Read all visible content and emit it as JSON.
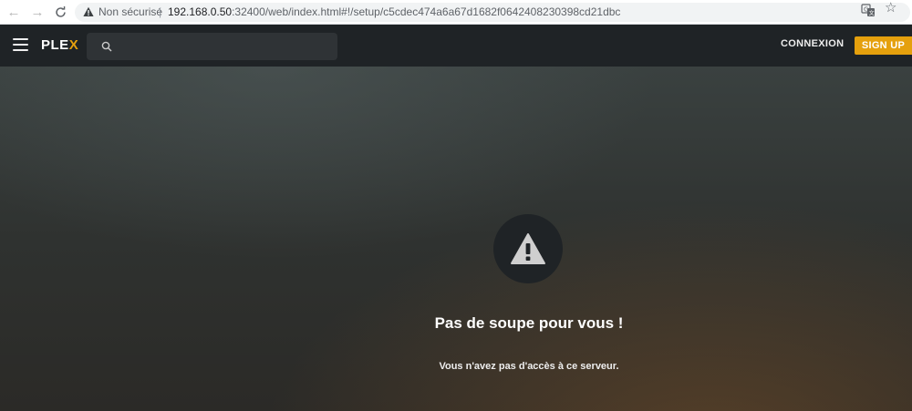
{
  "browser": {
    "back_glyph": "←",
    "forward_glyph": "→",
    "reload_glyph": "C",
    "security_label": "Non sécurisé",
    "url_host": "192.168.0.50",
    "url_path": ":32400/web/index.html#!/setup/c5cdec474a6a67d1682f0642408230398cd21dbc",
    "star_glyph": "☆"
  },
  "header": {
    "logo_prefix": "PLE",
    "logo_x": "X",
    "search_value": "",
    "login_label": "CONNEXION",
    "signup_label": "SIGN UP"
  },
  "error": {
    "title": "Pas de soupe pour vous !",
    "message": "Vous n'avez pas d'accès à ce serveur."
  },
  "colors": {
    "accent": "#e5a00d",
    "header_bg": "#1f2326",
    "alert_circle": "#1f2326",
    "alert_triangle": "#cfcfcf"
  },
  "icons": {
    "menu": "hamburger-menu-icon",
    "search": "search-icon",
    "warning": "warning-triangle-icon",
    "translate": "translate-icon",
    "bookmark": "star-icon"
  }
}
